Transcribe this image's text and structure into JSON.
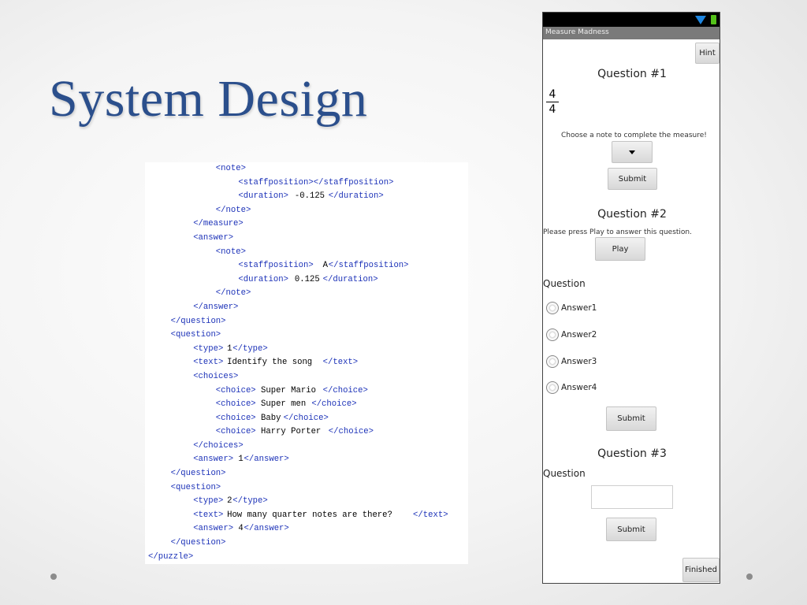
{
  "slide": {
    "title": "System Design"
  },
  "code_lines": [
    {
      "indent": 6,
      "parts": [
        {
          "t": "<note>",
          "k": "tag"
        }
      ]
    },
    {
      "indent": 8,
      "parts": [
        {
          "t": "<staffposition></staffposition>",
          "k": "tag"
        }
      ]
    },
    {
      "indent": 8,
      "parts": [
        {
          "t": "<duration>",
          "k": "tag"
        },
        {
          "t": "-0.125",
          "k": "txt"
        },
        {
          "t": "</duration>",
          "k": "tag"
        }
      ]
    },
    {
      "indent": 6,
      "parts": [
        {
          "t": "</note>",
          "k": "tag"
        }
      ]
    },
    {
      "indent": 4,
      "parts": [
        {
          "t": "</measure>",
          "k": "tag"
        }
      ]
    },
    {
      "indent": 4,
      "parts": [
        {
          "t": "<answer>",
          "k": "tag"
        }
      ]
    },
    {
      "indent": 6,
      "parts": [
        {
          "t": "<note>",
          "k": "tag"
        }
      ]
    },
    {
      "indent": 8,
      "parts": [
        {
          "t": "<staffposition>",
          "k": "tag"
        },
        {
          "t": "A",
          "k": "txt"
        },
        {
          "t": "</staffposition>",
          "k": "tag"
        }
      ]
    },
    {
      "indent": 8,
      "parts": [
        {
          "t": "<duration>",
          "k": "tag"
        },
        {
          "t": "0.125",
          "k": "txt"
        },
        {
          "t": "</duration>",
          "k": "tag"
        }
      ]
    },
    {
      "indent": 6,
      "parts": [
        {
          "t": "</note>",
          "k": "tag"
        }
      ]
    },
    {
      "indent": 4,
      "parts": [
        {
          "t": "</answer>",
          "k": "tag"
        }
      ]
    },
    {
      "indent": 2,
      "parts": [
        {
          "t": "</question>",
          "k": "tag"
        }
      ]
    },
    {
      "indent": 2,
      "parts": [
        {
          "t": "<question>",
          "k": "tag"
        }
      ]
    },
    {
      "indent": 4,
      "parts": [
        {
          "t": "<type>",
          "k": "tag"
        },
        {
          "t": "1",
          "k": "txt"
        },
        {
          "t": "</type>",
          "k": "tag"
        }
      ]
    },
    {
      "indent": 4,
      "parts": [
        {
          "t": "<text>",
          "k": "tag"
        },
        {
          "t": "Identify the song",
          "k": "txt"
        },
        {
          "t": "</text>",
          "k": "tag"
        }
      ]
    },
    {
      "indent": 4,
      "parts": [
        {
          "t": "<choices>",
          "k": "tag"
        }
      ]
    },
    {
      "indent": 6,
      "parts": [
        {
          "t": "<choice>",
          "k": "tag"
        },
        {
          "t": "Super Mario",
          "k": "txt"
        },
        {
          "t": "</choice>",
          "k": "tag"
        }
      ]
    },
    {
      "indent": 6,
      "parts": [
        {
          "t": "<choice>",
          "k": "tag"
        },
        {
          "t": "Super men",
          "k": "txt"
        },
        {
          "t": "</choice>",
          "k": "tag"
        }
      ]
    },
    {
      "indent": 6,
      "parts": [
        {
          "t": "<choice>",
          "k": "tag"
        },
        {
          "t": "Baby",
          "k": "txt"
        },
        {
          "t": "</choice>",
          "k": "tag"
        }
      ]
    },
    {
      "indent": 6,
      "parts": [
        {
          "t": "<choice>",
          "k": "tag"
        },
        {
          "t": "Harry Porter",
          "k": "txt"
        },
        {
          "t": "</choice>",
          "k": "tag"
        }
      ]
    },
    {
      "indent": 4,
      "parts": [
        {
          "t": "</choices>",
          "k": "tag"
        }
      ]
    },
    {
      "indent": 4,
      "parts": [
        {
          "t": "<answer>",
          "k": "tag"
        },
        {
          "t": "1",
          "k": "txt"
        },
        {
          "t": "</answer>",
          "k": "tag"
        }
      ]
    },
    {
      "indent": 2,
      "parts": [
        {
          "t": "</question>",
          "k": "tag"
        }
      ]
    },
    {
      "indent": 2,
      "parts": [
        {
          "t": "<question>",
          "k": "tag"
        }
      ]
    },
    {
      "indent": 4,
      "parts": [
        {
          "t": "<type>",
          "k": "tag"
        },
        {
          "t": "2",
          "k": "txt"
        },
        {
          "t": "</type>",
          "k": "tag"
        }
      ]
    },
    {
      "indent": 4,
      "parts": [
        {
          "t": "<text>",
          "k": "tag"
        },
        {
          "t": "How many quarter notes are there?",
          "k": "txt"
        },
        {
          "t": "</text>",
          "k": "tag"
        }
      ]
    },
    {
      "indent": 4,
      "parts": [
        {
          "t": "<answer>",
          "k": "tag"
        },
        {
          "t": "4",
          "k": "txt"
        },
        {
          "t": "</answer>",
          "k": "tag"
        }
      ]
    },
    {
      "indent": 2,
      "parts": [
        {
          "t": "</question>",
          "k": "tag"
        }
      ]
    },
    {
      "indent": 0,
      "parts": [
        {
          "t": "</puzzle>",
          "k": "tag"
        }
      ]
    }
  ],
  "phone": {
    "app_title": "Measure Madness",
    "hint_label": "Hint",
    "q1": {
      "heading": "Question #1",
      "time_sig_top": "4",
      "time_sig_bottom": "4",
      "instruction": "Choose a note to complete the measure!",
      "submit_label": "Submit"
    },
    "q2": {
      "heading": "Question #2",
      "instruction": "Please press Play to answer this question.",
      "play_label": "Play",
      "question_label": "Question",
      "answers": [
        "Answer1",
        "Answer2",
        "Answer3",
        "Answer4"
      ],
      "submit_label": "Submit"
    },
    "q3": {
      "heading": "Question #3",
      "question_label": "Question",
      "input_value": "",
      "submit_label": "Submit"
    },
    "finished_label": "Finished"
  },
  "colors": {
    "title": "#2b4f8c",
    "xml_tag": "#1c32b8",
    "wifi": "#1e86e0",
    "battery": "#54c21a"
  }
}
